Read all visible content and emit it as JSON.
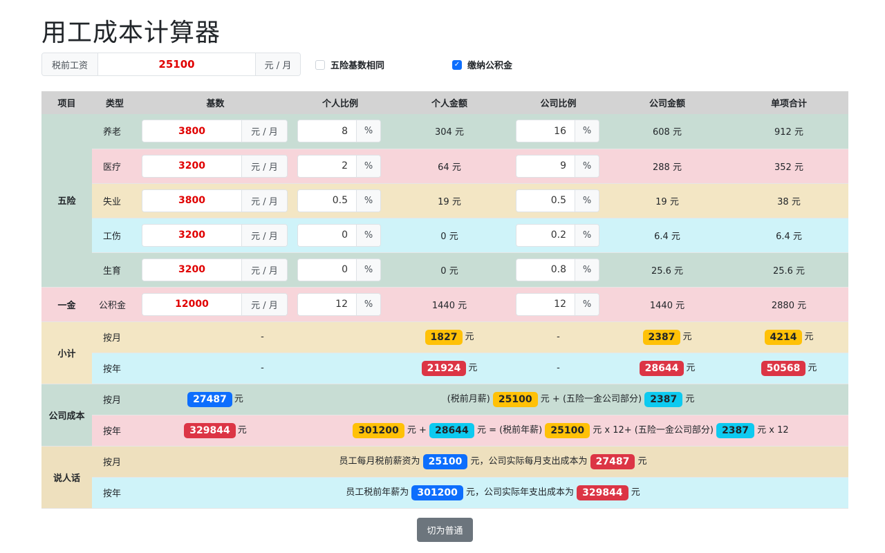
{
  "title": "用工成本计算器",
  "salary": {
    "label": "税前工资",
    "value": "25100",
    "unit": "元 / 月"
  },
  "options": [
    {
      "label": "五险基数相同",
      "checked": false
    },
    {
      "label": "缴纳公积金",
      "checked": true
    }
  ],
  "headers": [
    "项目",
    "类型",
    "基数",
    "个人比例",
    "个人金额",
    "公司比例",
    "公司金额",
    "单项合计"
  ],
  "groups": {
    "wuxian": "五险",
    "yijin": "一金",
    "subtotal": "小计",
    "company_cost": "公司成本",
    "plain": "说人话"
  },
  "base_unit": "元 / 月",
  "pct_unit": "%",
  "yuan": "元",
  "dash": "-",
  "monthly": "按月",
  "yearly": "按年",
  "rows": [
    {
      "type": "养老",
      "base": "3800",
      "p_rate": "8",
      "p_amt": "304 元",
      "c_rate": "16",
      "c_amt": "608 元",
      "total": "912 元"
    },
    {
      "type": "医疗",
      "base": "3200",
      "p_rate": "2",
      "p_amt": "64 元",
      "c_rate": "9",
      "c_amt": "288 元",
      "total": "352 元"
    },
    {
      "type": "失业",
      "base": "3800",
      "p_rate": "0.5",
      "p_amt": "19 元",
      "c_rate": "0.5",
      "c_amt": "19 元",
      "total": "38 元"
    },
    {
      "type": "工伤",
      "base": "3200",
      "p_rate": "0",
      "p_amt": "0 元",
      "c_rate": "0.2",
      "c_amt": "6.4 元",
      "total": "6.4 元"
    },
    {
      "type": "生育",
      "base": "3200",
      "p_rate": "0",
      "p_amt": "0 元",
      "c_rate": "0.8",
      "c_amt": "25.6 元",
      "total": "25.6 元"
    },
    {
      "type": "公积金",
      "base": "12000",
      "p_rate": "12",
      "p_amt": "1440 元",
      "c_rate": "12",
      "c_amt": "1440 元",
      "total": "2880 元"
    }
  ],
  "subtotal": {
    "monthly": {
      "personal": "1827",
      "company": "2387",
      "total": "4214"
    },
    "yearly": {
      "personal": "21924",
      "company": "28644",
      "total": "50568"
    }
  },
  "company_cost": {
    "monthly": {
      "value": "27487",
      "f1": "(税前月薪)",
      "salary": "25100",
      "f2": "元 + (五险一金公司部分)",
      "company": "2387",
      "f3": "元"
    },
    "yearly": {
      "value": "329844",
      "salary_year": "301200",
      "f1": "元 +",
      "company_year": "28644",
      "f2": "元 = (税前年薪)",
      "salary": "25100",
      "f3": "元 x 12+ (五险一金公司部分)",
      "company": "2387",
      "f4": "元 x 12"
    }
  },
  "plain": {
    "monthly": {
      "t1": "员工每月税前薪资为",
      "v1": "25100",
      "t2": "元，公司实际每月支出成本为",
      "v2": "27487",
      "t3": "元"
    },
    "yearly": {
      "t1": "员工税前年薪为",
      "v1": "301200",
      "t2": "元，公司实际年支出成本为",
      "v2": "329844",
      "t3": "元"
    }
  },
  "toggle_label": "切为普通"
}
